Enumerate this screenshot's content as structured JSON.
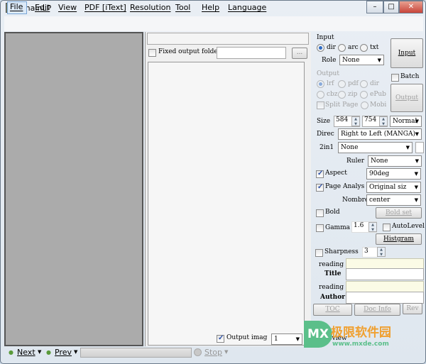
{
  "window": {
    "title": "ChainLP",
    "controls": [
      "–",
      "□",
      "✕"
    ]
  },
  "menu": [
    "File",
    "Edit",
    "View",
    "PDF [iText]",
    "Resolution",
    "Tool",
    "Help",
    "Language"
  ],
  "middle": {
    "path_value": "",
    "fixed_output_label": "Fixed output folde",
    "fixed_output_value": "",
    "browse_label": "...",
    "output_image_label": "Output imag",
    "output_image_value": "1"
  },
  "input": {
    "group": "Input",
    "radios": [
      "dir",
      "arc",
      "txt"
    ],
    "selected": "dir",
    "role_label": "Role",
    "role_value": "None",
    "button": "Input"
  },
  "output": {
    "group": "Output",
    "radios": [
      "lrf",
      "pdf",
      "dir",
      "cbz",
      "zip",
      "ePub"
    ],
    "split_label": "Split Page",
    "mobi_label": "Mobi",
    "batch_label": "Batch",
    "button": "Output"
  },
  "settings": {
    "size_label": "Size",
    "width": "584",
    "height": "754",
    "quality": "Normal",
    "direc_label": "Direc",
    "direc_value": "Right to Left (MANGA)",
    "twoin1_label": "2in1",
    "twoin1_value": "None",
    "ruler_label": "Ruler",
    "ruler_value": "None",
    "aspect_label": "Aspect",
    "aspect_checked": true,
    "aspect_value": "90deg",
    "page_label": "Page Analys",
    "page_checked": true,
    "page_value": "Original siz",
    "nombre_label": "Nombre",
    "nombre_value": "center",
    "bold_label": "Bold",
    "bold_set": "Bold set",
    "gamma_label": "Gamma",
    "gamma_value": "1.6",
    "autolevel_label": "AutoLevel",
    "histgram": "Histgram",
    "sharpness_label": "Sharpness",
    "sharpness_value": "3",
    "reading1": "reading",
    "title_label": "Title",
    "reading2": "reading",
    "author_label": "Author",
    "toc": "TOC",
    "docinfo": "Doc Info",
    "rev": "Rev",
    "preview_label": "Preview"
  },
  "bottom": {
    "next": "Next",
    "prev": "Prev",
    "stop": "Stop"
  },
  "watermark": {
    "logo": "MX",
    "text": "极限软件园",
    "url": "www.mxde.com"
  }
}
